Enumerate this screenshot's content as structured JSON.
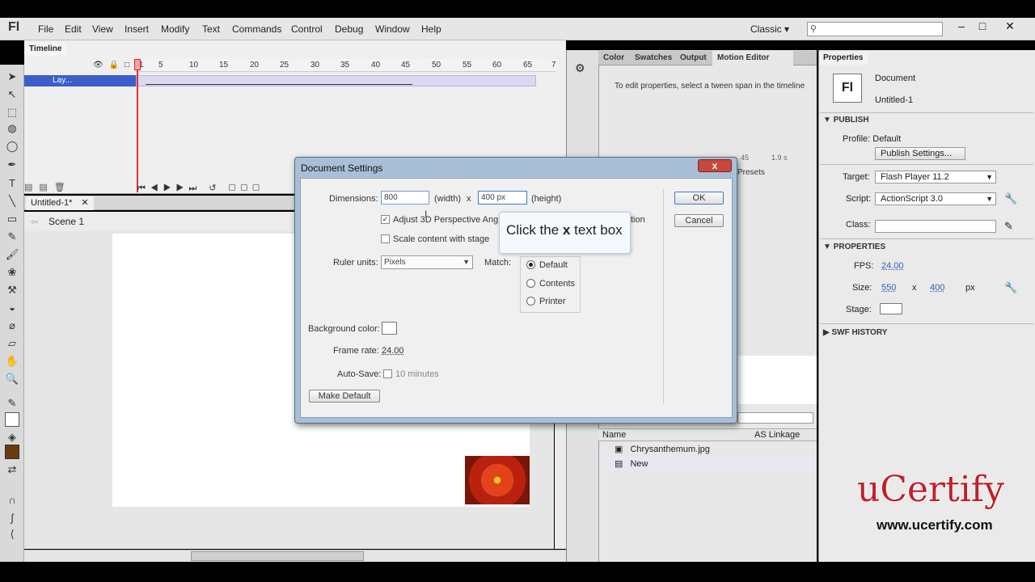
{
  "app": {
    "logo": "Fl",
    "workspace": "Classic",
    "search_placeholder": ""
  },
  "menu": [
    "File",
    "Edit",
    "View",
    "Insert",
    "Modify",
    "Text",
    "Commands",
    "Control",
    "Debug",
    "Window",
    "Help"
  ],
  "window_buttons": [
    "–",
    "□",
    "✕"
  ],
  "timeline": {
    "tab": "Timeline",
    "frame_numbers": [
      "1",
      "5",
      "10",
      "15",
      "20",
      "25",
      "30",
      "35",
      "40",
      "45",
      "50",
      "55",
      "60",
      "65",
      "7"
    ],
    "layer_name": "Lay..."
  },
  "document": {
    "tab": "Untitled-1*",
    "scene": "Scene 1"
  },
  "mid_panel": {
    "tabs": [
      "Color",
      "Swatches",
      "Output",
      "Motion Editor"
    ],
    "message": "To edit properties, select a tween span in the timeline",
    "presets": "Presets",
    "library_columns": [
      "Name",
      "AS Linkage"
    ],
    "library_items": [
      "Chrysanthemum.jpg",
      "New"
    ],
    "ruler_values": [
      "45",
      "1.9 s"
    ]
  },
  "properties": {
    "tab": "Properties",
    "icon": "Fl",
    "type": "Document",
    "name": "Untitled-1",
    "publish_header": "PUBLISH",
    "profile": "Profile:  Default",
    "publish_settings": "Publish Settings...",
    "target_label": "Target:",
    "target_value": "Flash Player 11.2",
    "script_label": "Script:",
    "script_value": "ActionScript 3.0",
    "class_label": "Class:",
    "properties_header": "PROPERTIES",
    "fps_label": "FPS:",
    "fps_value": "24.00",
    "size_label": "Size:",
    "size_w": "550",
    "size_x": "x",
    "size_h": "400",
    "size_unit": "px",
    "stage_label": "Stage:",
    "swf_history": "SWF HISTORY"
  },
  "dialog": {
    "title": "Document Settings",
    "close": "x",
    "dimensions_label": "Dimensions:",
    "width_value": "800",
    "width_label": "(width)",
    "x": "x",
    "height_value": "400 px",
    "height_label": "(height)",
    "adjust_3d": "Adjust 3D Perspective Angl",
    "adjust_tail": "tion",
    "scale_content": "Scale content with stage",
    "ruler_label": "Ruler units:",
    "ruler_value": "Pixels",
    "match_label": "Match:",
    "match_options": [
      "Default",
      "Contents",
      "Printer"
    ],
    "bg_label": "Background color:",
    "frame_rate_label": "Frame rate:",
    "frame_rate_value": "24.00",
    "autosave_label": "Auto-Save:",
    "autosave_value": "10 minutes",
    "make_default": "Make Default",
    "ok": "OK",
    "cancel": "Cancel"
  },
  "tooltip": {
    "prefix": "Click the ",
    "bold": "x",
    "suffix": " text box"
  },
  "watermark": {
    "brand": "uCertify",
    "url": "www.ucertify.com"
  }
}
